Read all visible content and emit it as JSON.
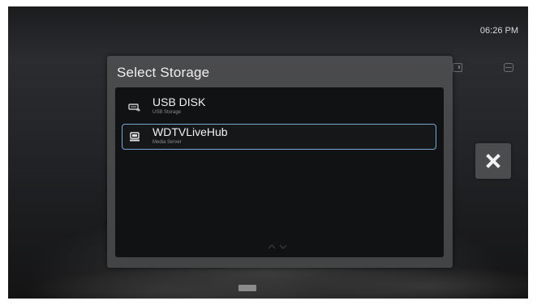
{
  "status": {
    "time": "06:26 PM"
  },
  "dialog": {
    "title": "Select Storage",
    "items": [
      {
        "name": "USB DISK",
        "type": "USB Storage",
        "icon": "usb-drive-icon",
        "selected": false
      },
      {
        "name": "WDTVLiveHub",
        "type": "Media Server",
        "icon": "media-server-icon",
        "selected": true
      }
    ]
  },
  "colors": {
    "selection_border": "#7aa6d6",
    "dialog_background": "#4a4b4d",
    "list_background": "#111213"
  },
  "controls": {
    "close_icon": "close-icon",
    "scroll_icons": [
      "chevron-up-icon",
      "chevron-down-icon"
    ]
  }
}
